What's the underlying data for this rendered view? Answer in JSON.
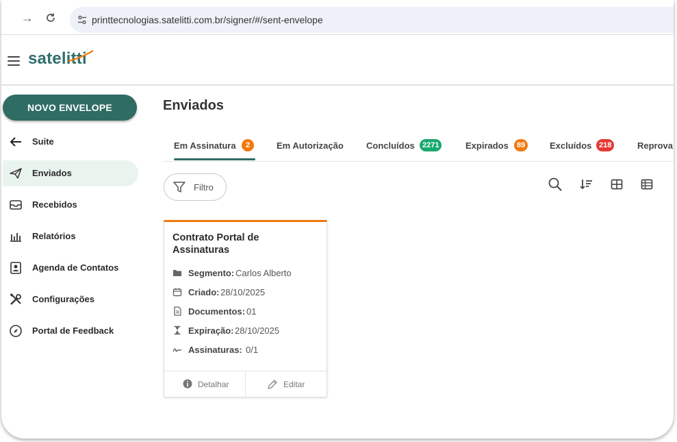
{
  "browser": {
    "url": "printtecnologias.satelitti.com.br/signer/#/sent-envelope"
  },
  "app": {
    "logo": "satelitti"
  },
  "sidebar": {
    "new_button": "NOVO ENVELOPE",
    "items": [
      {
        "label": "Suite",
        "icon": "arrow-left-icon"
      },
      {
        "label": "Enviados",
        "icon": "send-icon"
      },
      {
        "label": "Recebidos",
        "icon": "inbox-icon"
      },
      {
        "label": "Relatórios",
        "icon": "bar-chart-icon"
      },
      {
        "label": "Agenda de Contatos",
        "icon": "contacts-icon"
      },
      {
        "label": "Configurações",
        "icon": "tools-icon"
      },
      {
        "label": "Portal de Feedback",
        "icon": "compass-icon"
      }
    ]
  },
  "main": {
    "title": "Enviados",
    "tabs": [
      {
        "label": "Em Assinatura",
        "badge": "2",
        "badge_color": "#f2790f"
      },
      {
        "label": "Em Autorização",
        "badge": "",
        "badge_color": ""
      },
      {
        "label": "Concluídos",
        "badge": "2271",
        "badge_color": "#1aa870"
      },
      {
        "label": "Expirados",
        "badge": "89",
        "badge_color": "#f2790f"
      },
      {
        "label": "Excluídos",
        "badge": "218",
        "badge_color": "#e53935"
      },
      {
        "label": "Reprova",
        "badge": "",
        "badge_color": ""
      }
    ],
    "filter_label": "Filtro",
    "toolbar_icons": [
      "search-icon",
      "sort-icon",
      "grid-view-icon",
      "table-view-icon"
    ]
  },
  "card": {
    "title": "Contrato Portal de Assinaturas",
    "accent_color": "#f2790f",
    "rows": [
      {
        "key": "Segmento:",
        "value": "Carlos Alberto",
        "icon": "folder-icon"
      },
      {
        "key": "Criado:",
        "value": "28/10/2025",
        "icon": "calendar-icon"
      },
      {
        "key": "Documentos:",
        "value": "01",
        "icon": "document-icon"
      },
      {
        "key": "Expiração:",
        "value": "28/10/2025",
        "icon": "hourglass-icon"
      },
      {
        "key": "Assinaturas:",
        "value": "0/1",
        "icon": "signature-icon"
      }
    ],
    "actions": [
      {
        "label": "Detalhar",
        "icon": "info-icon"
      },
      {
        "label": "Editar",
        "icon": "pencil-icon"
      }
    ]
  }
}
